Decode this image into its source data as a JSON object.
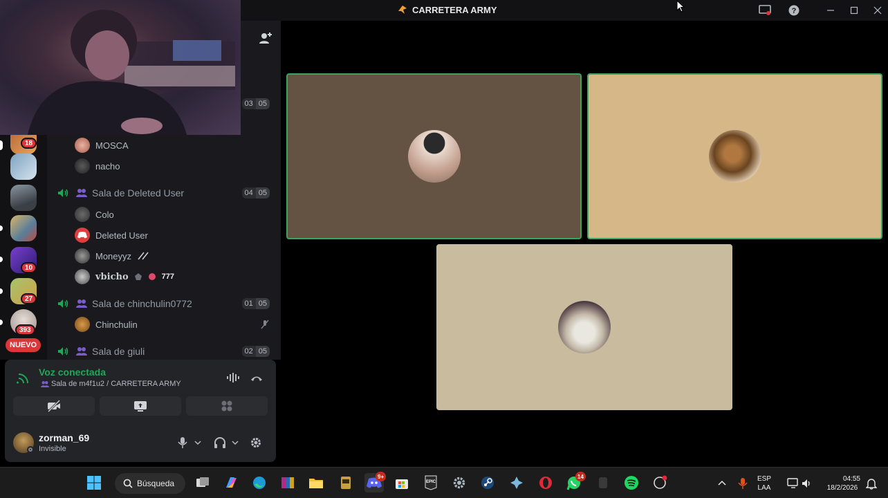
{
  "window": {
    "title": "CARRETERA ARMY"
  },
  "servers": [
    {
      "badge": "18"
    },
    {
      "badge": ""
    },
    {
      "badge": ""
    },
    {
      "badge": ""
    },
    {
      "badge": "10"
    },
    {
      "badge": "27"
    },
    {
      "badge": "393"
    }
  ],
  "servers_new_label": "NUEVO",
  "channels": [
    {
      "name": "",
      "count_in": "03",
      "count_max": "05"
    },
    {
      "name": "Sala de Deleted User",
      "count_in": "04",
      "count_max": "05"
    },
    {
      "name": "Sala de chinchulin0772",
      "count_in": "01",
      "count_max": "05"
    },
    {
      "name": "Sala de giuli",
      "count_in": "02",
      "count_max": "05"
    }
  ],
  "users": {
    "mosca": "MOSCA",
    "nacho": "nacho",
    "colo": "Colo",
    "deleted": "Deleted User",
    "moneyyz": "Moneyyz",
    "vbicho": "vbicho",
    "vbicho_tag": "777",
    "chinchulin": "Chinchulin"
  },
  "voice": {
    "status": "Voz conectada",
    "location": "Sala de m4f1u2 / CARRETERA ARMY"
  },
  "account": {
    "username": "zorman_69",
    "status": "Invisible"
  },
  "taskbar": {
    "search": "Búsqueda",
    "discord_badge": "9+",
    "whatsapp_badge": "14",
    "lang": "ESP",
    "layout": "LAA",
    "time": "04:55",
    "date": "18/2/2026"
  },
  "colors": {
    "speaking": "#3ba55d",
    "voice_connected": "#23a55a",
    "badge": "#da373c",
    "tile1": "#645343",
    "tile2": "#d6b888",
    "tile3": "#c9bb9d"
  }
}
